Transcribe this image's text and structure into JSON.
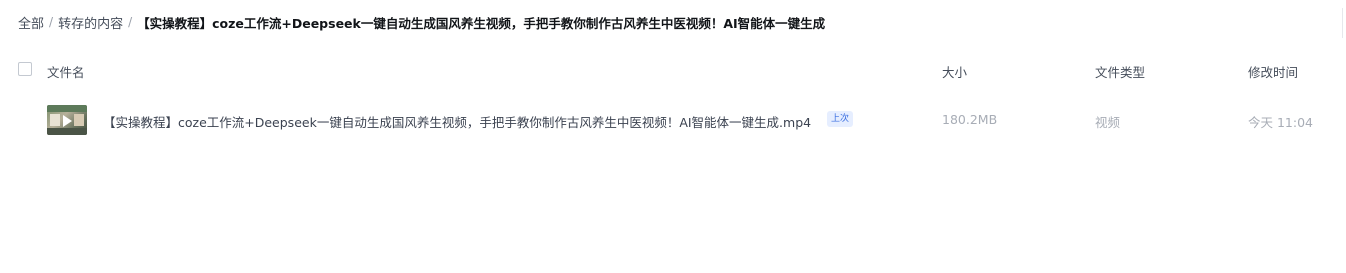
{
  "breadcrumb": {
    "root": "全部",
    "separator": "/",
    "parent": "转存的内容",
    "current": "【实操教程】coze工作流+Deepseek一键自动生成国风养生视频，手把手教你制作古风养生中医视频！AI智能体一键生成"
  },
  "table": {
    "headers": {
      "name": "文件名",
      "size": "大小",
      "type": "文件类型",
      "modified": "修改时间"
    },
    "rows": [
      {
        "thumbnail_icon": "video-thumbnail-icon",
        "name": "【实操教程】coze工作流+Deepseek一键自动生成国风养生视频，手把手教你制作古风养生中医视频！AI智能体一键生成.mp4",
        "badge": "上次",
        "size": "180.2MB",
        "type": "视频",
        "modified": "今天 11:04"
      }
    ]
  },
  "colors": {
    "badge_bg": "#e6eeff",
    "badge_text": "#3b6fe0",
    "muted_text": "#a8adb6"
  }
}
